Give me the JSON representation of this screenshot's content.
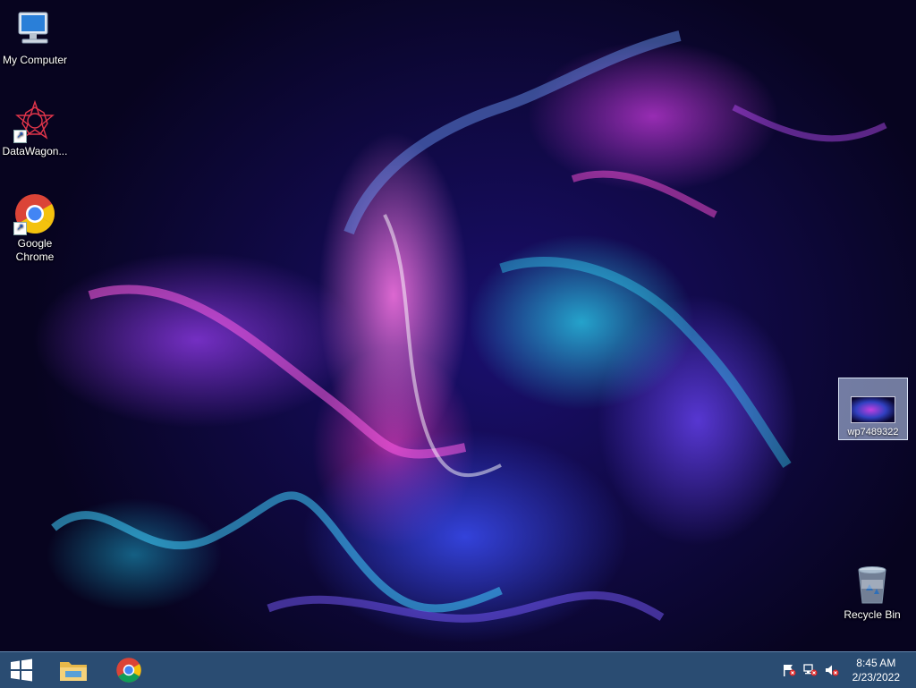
{
  "desktop": {
    "icons": [
      {
        "label": "My Computer",
        "icon": "computer-icon"
      },
      {
        "label": "DataWagon...",
        "icon": "datawagon-icon"
      },
      {
        "label": "Google Chrome",
        "icon": "chrome-icon"
      },
      {
        "label": "Recycle Bin",
        "icon": "recycle-bin-icon"
      }
    ],
    "selected_file": {
      "label": "wp7489322",
      "icon": "image-file-icon"
    }
  },
  "taskbar": {
    "pinned": [
      {
        "name": "start",
        "icon": "windows-logo-icon"
      },
      {
        "name": "file-explorer",
        "icon": "folder-icon"
      },
      {
        "name": "google-chrome",
        "icon": "chrome-icon"
      }
    ],
    "tray": {
      "icons": [
        "action-center-flag-icon",
        "network-icon",
        "volume-muted-icon"
      ],
      "time": "8:45 AM",
      "date": "2/23/2022"
    }
  },
  "colors": {
    "taskbar": "#2d527a",
    "selection": "#c8dcff",
    "chrome_red": "#db4437",
    "chrome_yellow": "#f4c20d",
    "chrome_green": "#0f9d58",
    "chrome_blue": "#4285f4"
  }
}
